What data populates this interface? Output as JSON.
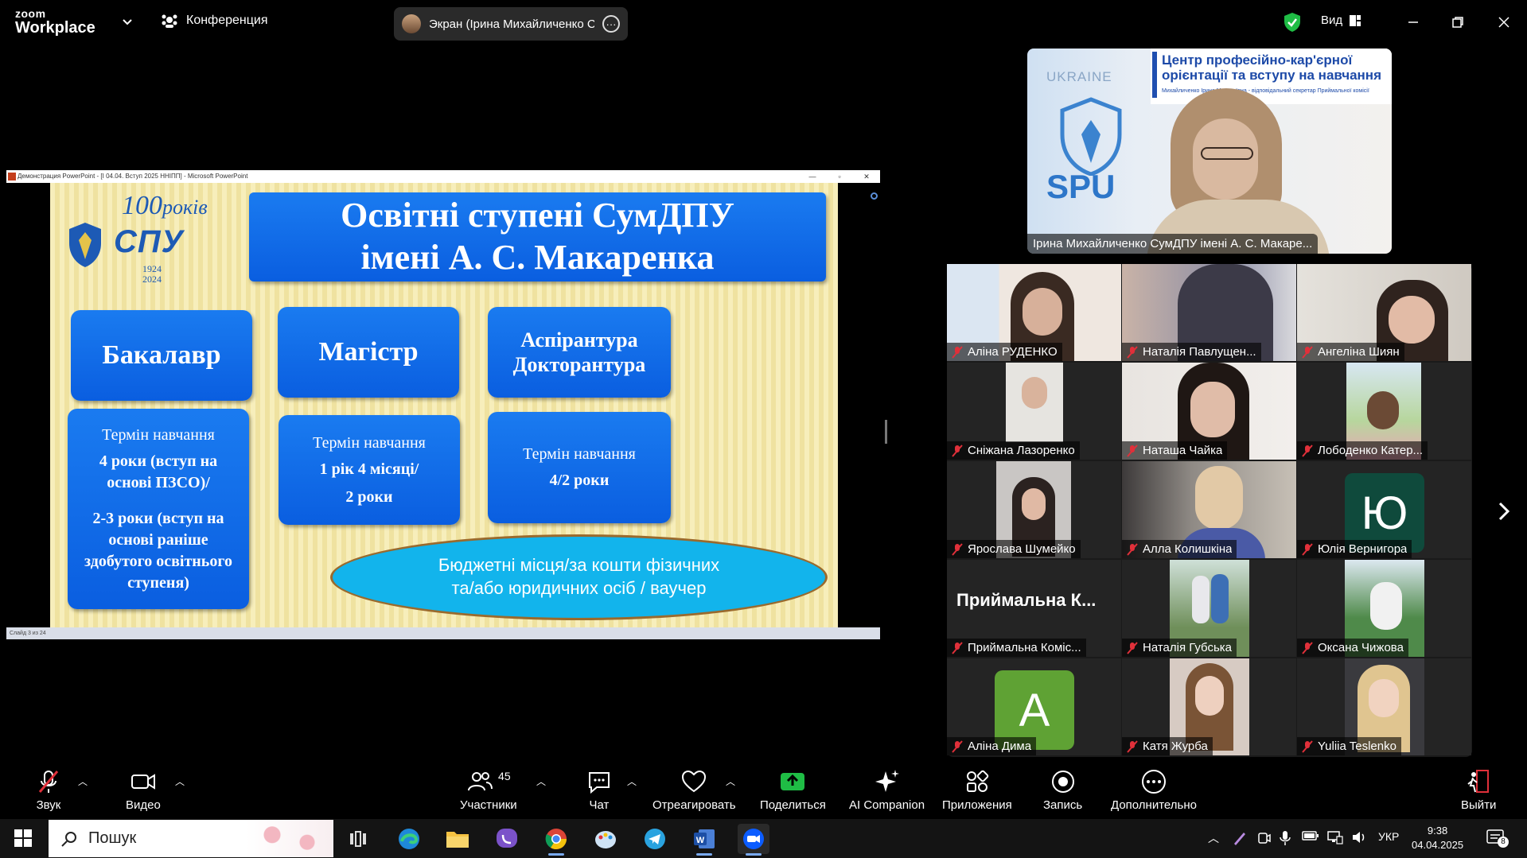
{
  "topbar": {
    "logo_line1": "zoom",
    "logo_line2": "Workplace",
    "conference_label": "Конференция",
    "screen_share_label": "Экран (Ірина Михайличенко Су",
    "view_label": "Вид"
  },
  "ppt": {
    "window_title": "Демонстрация PowerPoint - [І 04.04. Вступ 2025 ННІПП] - Microsoft PowerPoint",
    "status": "Слайд 3 из 24",
    "slide": {
      "logo_100": "100",
      "logo_rokiv": "років",
      "logo_spu": "СПУ",
      "logo_years": "1924 2024",
      "title_line1": "Освітні ступені СумДПУ",
      "title_line2": "імені А. С. Макаренка",
      "bachelor": "Бакалавр",
      "master": "Магістр",
      "phd_line1": "Аспірантура",
      "phd_line2": "Докторантура",
      "term_label": "Термін навчання",
      "bachelor_term_1": "4 роки (вступ на основі ПЗСО)/",
      "bachelor_term_2": "2-3 роки (вступ на основі раніше здобутого освітнього ступеня)",
      "master_term_1": "1 рік 4 місяці/",
      "master_term_2": "2 роки",
      "phd_term": "4/2 роки",
      "budget_line1": "Бюджетні місця/за кошти фізичних",
      "budget_line2": "та/або юридичних осіб / ваучер"
    }
  },
  "speaker": {
    "board_title_1": "Центр професійно-кар'єрної",
    "board_title_2": "орієнтації та вступу на навчання",
    "board_subtitle": "Михайличенко Ірина Миколаївна - відповідальний секретар Приймальної комісії",
    "ukraine": "UKRAINE",
    "spu": "SPU",
    "name": "Ірина Михайличенко СумДПУ імені А. С. Макаре..."
  },
  "gallery": {
    "tiles": [
      {
        "name": "Аліна РУДЕНКО"
      },
      {
        "name": "Наталія Павлущен..."
      },
      {
        "name": "Ангеліна Шиян"
      },
      {
        "name": "Сніжана Лазоренко"
      },
      {
        "name": "Наташа Чайка"
      },
      {
        "name": "Лободенко Катер..."
      },
      {
        "name": "Ярослава Шумейко"
      },
      {
        "name": "Алла Колишкіна"
      },
      {
        "name": "Юлія Вернигора",
        "avatar_letter": "Ю",
        "avatar_color": "#0f4a3c"
      },
      {
        "name": "Приймальна Коміс...",
        "display_text": "Приймальна К..."
      },
      {
        "name": "Наталія Губська"
      },
      {
        "name": "Оксана Чижова"
      },
      {
        "name": "Аліна Дима",
        "avatar_letter": "А",
        "avatar_color": "#5fa234"
      },
      {
        "name": "Катя Журба"
      },
      {
        "name": "Yuliia Teslenko"
      }
    ]
  },
  "toolbar": {
    "audio": "Звук",
    "video": "Видео",
    "participants": "Участники",
    "participants_count": "45",
    "chat": "Чат",
    "react": "Отреагировать",
    "share": "Поделиться",
    "ai": "AI Companion",
    "apps": "Приложения",
    "record": "Запись",
    "more": "Дополнительно",
    "leave": "Выйти"
  },
  "taskbar": {
    "search_placeholder": "Пошук",
    "lang": "УКР",
    "time": "9:38",
    "date": "04.04.2025",
    "notif_count": "8"
  },
  "colors": {
    "slide_blue": "#0a5ee0",
    "ellipse_blue": "#12b4ec",
    "muted_red": "#e0303a",
    "share_green": "#1fbd45"
  }
}
